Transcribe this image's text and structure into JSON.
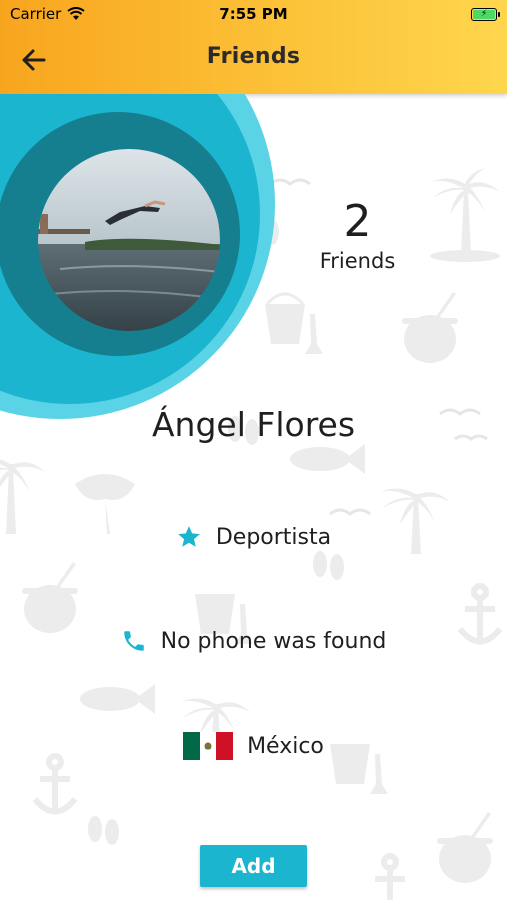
{
  "status_bar": {
    "carrier": "Carrier",
    "time": "7:55 PM"
  },
  "header": {
    "title": "Friends",
    "back_icon": "arrow-left-icon"
  },
  "profile": {
    "friends_count": "2",
    "friends_label": "Friends",
    "name": "Ángel Flores",
    "occupation": "Deportista",
    "phone": "No phone was found",
    "country": "México"
  },
  "actions": {
    "add_label": "Add"
  },
  "colors": {
    "header_start": "#f8a51e",
    "header_end": "#fed64d",
    "accent": "#1cb5cf",
    "icon": "#1cb5cf",
    "pattern": "#e9e9e9"
  }
}
